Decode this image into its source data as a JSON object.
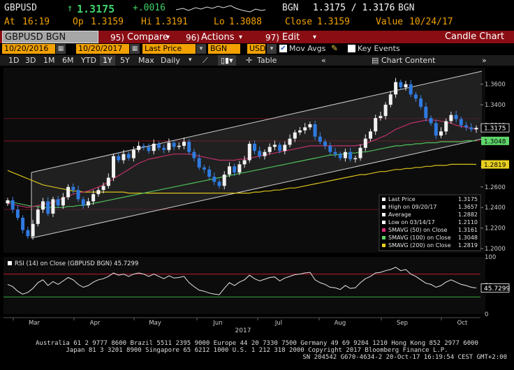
{
  "header": {
    "ticker": "GBPUSD",
    "arrow": "↑",
    "last": "1.3175",
    "change": "+.0016",
    "source": "BGN",
    "bidask": "1.3175 / 1.3176",
    "source2": "BGN",
    "at_label": "At",
    "time": "16:19",
    "op_label": "Op",
    "open": "1.3159",
    "hi_label": "Hi",
    "high": "1.3191",
    "lo_label": "Lo",
    "low": "1.3088",
    "close_label": "Close",
    "close": "1.3159",
    "value_label": "Value",
    "date": "10/24/17"
  },
  "toolbar": {
    "security": "GBPUSD BGN Curncy",
    "compare_num": "95)",
    "compare": "Compare",
    "actions_num": "96)",
    "actions": "Actions",
    "edit_num": "97)",
    "edit": "Edit",
    "title": "Candle Chart"
  },
  "controls": {
    "start_date": "10/20/2016",
    "end_date": "10/20/2017",
    "field": "Last Price",
    "source": "BGN",
    "currency": "USD",
    "mov_avgs": "Mov Avgs",
    "key_events": "Key Events"
  },
  "timeframes": [
    "1D",
    "3D",
    "1M",
    "6M",
    "YTD",
    "1Y",
    "5Y",
    "Max"
  ],
  "selected_timeframe": "1Y",
  "periodicity": "Daily",
  "table_label": "Table",
  "chart_content_label": "Chart Content",
  "chart_data": {
    "type": "candlestick",
    "x_labels": [
      "Mar",
      "Apr",
      "May",
      "Jun",
      "Jul",
      "Aug",
      "Sep",
      "Oct"
    ],
    "year_label": "2017",
    "y_ticks": [
      "1.3600",
      "1.3400",
      "1.3200",
      "1.2800",
      "1.2600",
      "1.2400",
      "1.2200",
      "1.2000"
    ],
    "ylim": [
      1.196,
      1.376
    ],
    "last_price": 1.3175,
    "last_price_label": "1.3175",
    "sma100_label": "1.3048",
    "sma200_label": "1.2819",
    "close_series": [
      1.247,
      1.238,
      1.23,
      1.218,
      1.212,
      1.224,
      1.238,
      1.246,
      1.234,
      1.248,
      1.242,
      1.25,
      1.26,
      1.257,
      1.248,
      1.242,
      1.246,
      1.253,
      1.257,
      1.261,
      1.269,
      1.29,
      1.286,
      1.292,
      1.288,
      1.296,
      1.3,
      1.299,
      1.295,
      1.302,
      1.298,
      1.296,
      1.303,
      1.299,
      1.3,
      1.304,
      1.294,
      1.288,
      1.279,
      1.277,
      1.27,
      1.265,
      1.261,
      1.272,
      1.28,
      1.274,
      1.282,
      1.286,
      1.302,
      1.295,
      1.29,
      1.294,
      1.299,
      1.301,
      1.295,
      1.301,
      1.307,
      1.313,
      1.315,
      1.318,
      1.321,
      1.309,
      1.304,
      1.3,
      1.294,
      1.292,
      1.288,
      1.294,
      1.287,
      1.288,
      1.298,
      1.307,
      1.314,
      1.327,
      1.329,
      1.34,
      1.35,
      1.362,
      1.357,
      1.36,
      1.35,
      1.346,
      1.338,
      1.327,
      1.322,
      1.31,
      1.314,
      1.324,
      1.33,
      1.326,
      1.32,
      1.318,
      1.316,
      1.3175
    ],
    "sma50": [
      1.244,
      1.243,
      1.242,
      1.241,
      1.24,
      1.241,
      1.242,
      1.243,
      1.244,
      1.245,
      1.247,
      1.249,
      1.251,
      1.253,
      1.254,
      1.255,
      1.256,
      1.258,
      1.26,
      1.262,
      1.265,
      1.268,
      1.271,
      1.274,
      1.277,
      1.28,
      1.283,
      1.285,
      1.287,
      1.288,
      1.289,
      1.29,
      1.291,
      1.292,
      1.292,
      1.292,
      1.292,
      1.291,
      1.29,
      1.289,
      1.288,
      1.287,
      1.286,
      1.286,
      1.286,
      1.286,
      1.287,
      1.287,
      1.288,
      1.289,
      1.29,
      1.291,
      1.292,
      1.293,
      1.294,
      1.295,
      1.296,
      1.297,
      1.298,
      1.299,
      1.3,
      1.3,
      1.3,
      1.3,
      1.3,
      1.3,
      1.3,
      1.3,
      1.3,
      1.3,
      1.301,
      1.302,
      1.304,
      1.306,
      1.308,
      1.31,
      1.313,
      1.316,
      1.318,
      1.32,
      1.322,
      1.323,
      1.324,
      1.325,
      1.325,
      1.325,
      1.324,
      1.323,
      1.322,
      1.32,
      1.319,
      1.318,
      1.317,
      1.3161
    ],
    "sma100": [
      1.246,
      1.245,
      1.244,
      1.243,
      1.242,
      1.241,
      1.241,
      1.24,
      1.24,
      1.24,
      1.24,
      1.24,
      1.241,
      1.241,
      1.242,
      1.242,
      1.243,
      1.244,
      1.245,
      1.246,
      1.247,
      1.248,
      1.249,
      1.25,
      1.251,
      1.252,
      1.253,
      1.254,
      1.255,
      1.256,
      1.257,
      1.258,
      1.259,
      1.26,
      1.261,
      1.262,
      1.263,
      1.264,
      1.265,
      1.266,
      1.267,
      1.268,
      1.269,
      1.27,
      1.271,
      1.272,
      1.273,
      1.274,
      1.275,
      1.276,
      1.277,
      1.278,
      1.279,
      1.28,
      1.281,
      1.282,
      1.283,
      1.284,
      1.285,
      1.286,
      1.287,
      1.288,
      1.289,
      1.29,
      1.291,
      1.291,
      1.292,
      1.292,
      1.293,
      1.293,
      1.294,
      1.294,
      1.295,
      1.296,
      1.297,
      1.298,
      1.299,
      1.3,
      1.3,
      1.301,
      1.301,
      1.302,
      1.302,
      1.303,
      1.303,
      1.303,
      1.304,
      1.304,
      1.304,
      1.304,
      1.304,
      1.305,
      1.305,
      1.3048
    ],
    "sma200": [
      1.276,
      1.274,
      1.272,
      1.27,
      1.268,
      1.266,
      1.264,
      1.262,
      1.261,
      1.26,
      1.259,
      1.258,
      1.257,
      1.256,
      1.256,
      1.255,
      1.255,
      1.255,
      1.255,
      1.255,
      1.255,
      1.255,
      1.255,
      1.255,
      1.254,
      1.254,
      1.254,
      1.254,
      1.254,
      1.254,
      1.254,
      1.254,
      1.254,
      1.254,
      1.254,
      1.254,
      1.254,
      1.254,
      1.254,
      1.254,
      1.254,
      1.254,
      1.254,
      1.254,
      1.254,
      1.254,
      1.254,
      1.254,
      1.254,
      1.255,
      1.255,
      1.256,
      1.256,
      1.257,
      1.257,
      1.258,
      1.259,
      1.259,
      1.26,
      1.261,
      1.262,
      1.263,
      1.264,
      1.265,
      1.266,
      1.267,
      1.268,
      1.269,
      1.27,
      1.271,
      1.272,
      1.272,
      1.273,
      1.274,
      1.275,
      1.275,
      1.276,
      1.277,
      1.277,
      1.278,
      1.278,
      1.279,
      1.279,
      1.28,
      1.28,
      1.281,
      1.281,
      1.281,
      1.282,
      1.282,
      1.282,
      1.282,
      1.282,
      1.2819
    ],
    "legend": [
      {
        "label": "Last Price",
        "value": "1.3175",
        "color": "#ffffff"
      },
      {
        "label": "High on 09/20/17",
        "value": "1.3657",
        "color": "#ffffff"
      },
      {
        "label": "Average",
        "value": "1.2882",
        "color": "#ffffff"
      },
      {
        "label": "Low on 03/14/17",
        "value": "1.2110",
        "color": "#ffffff"
      },
      {
        "label": "SMAVG (50) on Close",
        "value": "1.3161",
        "color": "#e0307a"
      },
      {
        "label": "SMAVG (100) on Close",
        "value": "1.3048",
        "color": "#5fd66a"
      },
      {
        "label": "SMAVG (200) on Close",
        "value": "1.2819",
        "color": "#e8d020"
      }
    ],
    "rsi_label": "RSI (14) on Close (GBPUSD BGN) 45.7299",
    "rsi_value": "45.7299",
    "rsi_ticks": [
      "100",
      "50",
      "0"
    ],
    "rsi": [
      52,
      48,
      40,
      35,
      38,
      45,
      55,
      60,
      50,
      57,
      52,
      58,
      64,
      60,
      52,
      47,
      50,
      56,
      60,
      62,
      66,
      72,
      68,
      70,
      66,
      70,
      72,
      70,
      66,
      70,
      66,
      62,
      67,
      63,
      64,
      66,
      55,
      48,
      42,
      40,
      37,
      35,
      34,
      45,
      55,
      50,
      56,
      60,
      68,
      62,
      58,
      61,
      64,
      65,
      58,
      63,
      66,
      69,
      70,
      72,
      73,
      60,
      55,
      52,
      47,
      46,
      43,
      50,
      45,
      46,
      55,
      62,
      66,
      72,
      73,
      76,
      78,
      82,
      76,
      78,
      70,
      66,
      60,
      54,
      52,
      47,
      50,
      56,
      60,
      56,
      52,
      50,
      47,
      45.73
    ]
  },
  "footer": {
    "line1": "Australia 61 2 9777 8600 Brazil 5511 2395 9000 Europe 44 20 7330 7500 Germany 49 69 9204 1210 Hong Kong 852 2977 6000",
    "line2": "Japan 81 3 3201 8900       Singapore 65 6212 1000       U.S. 1 212 318 2000        Copyright 2017 Bloomberg Finance L.P.",
    "line3": "SN 204542 G670-4634-2 20-Oct-17 16:19:54 CEST GMT+2:00"
  }
}
